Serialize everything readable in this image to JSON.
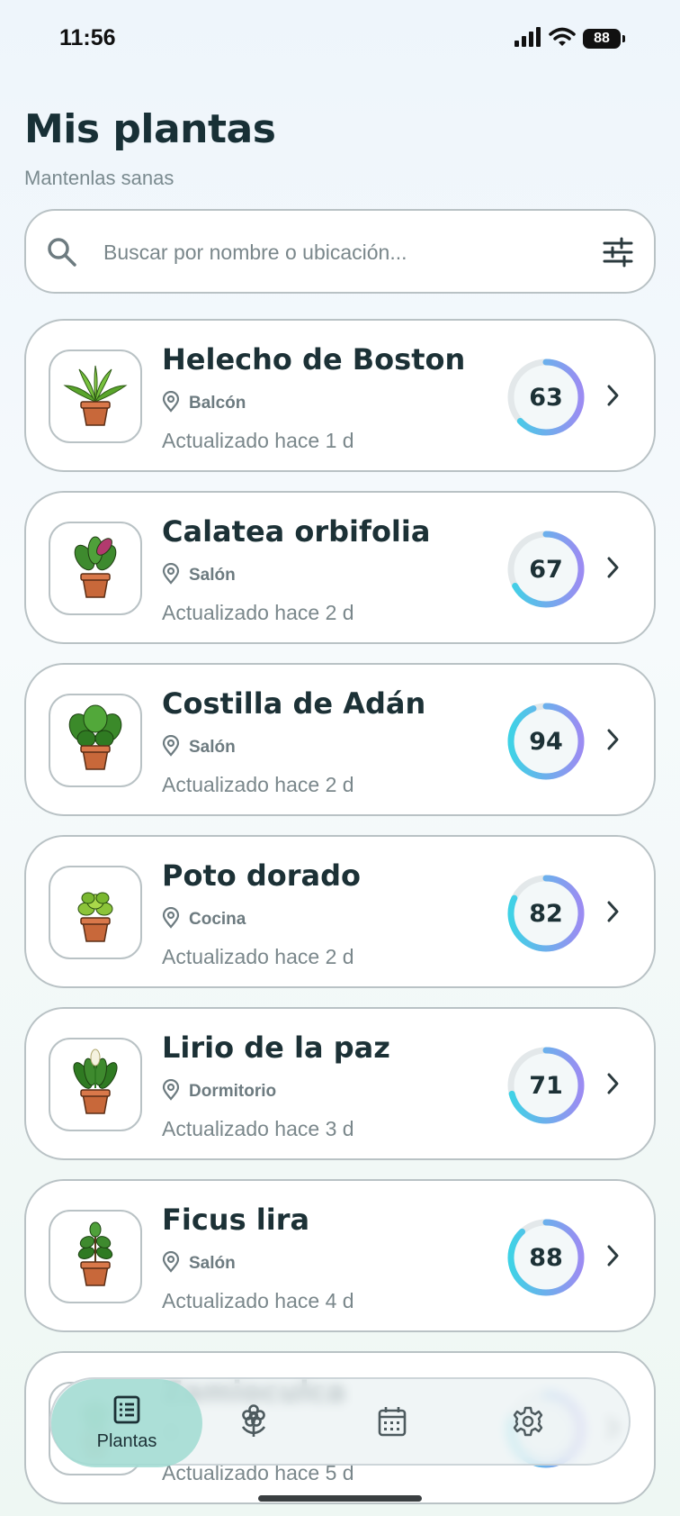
{
  "status_bar": {
    "time": "11:56",
    "battery": "88"
  },
  "header": {
    "title": "Mis plantas",
    "subtitle": "Mantenlas sanas"
  },
  "search": {
    "placeholder": "Buscar por nombre o ubicación...",
    "value": ""
  },
  "plants": [
    {
      "name": "Helecho de Boston",
      "location": "Balcón",
      "updated": "Actualizado hace 1 d",
      "score": "63",
      "score_fraction": 0.63,
      "plant_icon": "fern-icon"
    },
    {
      "name": "Calatea orbifolia",
      "location": "Salón",
      "updated": "Actualizado hace 2 d",
      "score": "67",
      "score_fraction": 0.67,
      "plant_icon": "calathea-icon"
    },
    {
      "name": "Costilla de Adán",
      "location": "Salón",
      "updated": "Actualizado hace 2 d",
      "score": "94",
      "score_fraction": 0.94,
      "plant_icon": "monstera-icon"
    },
    {
      "name": "Poto dorado",
      "location": "Cocina",
      "updated": "Actualizado hace 2 d",
      "score": "82",
      "score_fraction": 0.82,
      "plant_icon": "pothos-icon"
    },
    {
      "name": "Lirio de la paz",
      "location": "Dormitorio",
      "updated": "Actualizado hace 3 d",
      "score": "71",
      "score_fraction": 0.71,
      "plant_icon": "peace-lily-icon"
    },
    {
      "name": "Ficus lira",
      "location": "Salón",
      "updated": "Actualizado hace 4 d",
      "score": "88",
      "score_fraction": 0.88,
      "plant_icon": "ficus-icon"
    },
    {
      "name": "Zamioculca",
      "location": "",
      "updated": "Actualizado hace 5 d",
      "score": "",
      "score_fraction": 0.8,
      "plant_icon": "zz-plant-icon"
    }
  ],
  "nav": {
    "items": [
      {
        "label": "Plantas",
        "icon": "list-icon",
        "active": true
      },
      {
        "label": "",
        "icon": "flower-icon",
        "active": false
      },
      {
        "label": "",
        "icon": "calendar-icon",
        "active": false
      },
      {
        "label": "",
        "icon": "gear-icon",
        "active": false
      }
    ]
  },
  "colors": {
    "ring_start": "#3fd2e6",
    "ring_end": "#9b8cf2",
    "ring_track": "#e3e8ea",
    "accent_nav": "#a0dcd2"
  }
}
